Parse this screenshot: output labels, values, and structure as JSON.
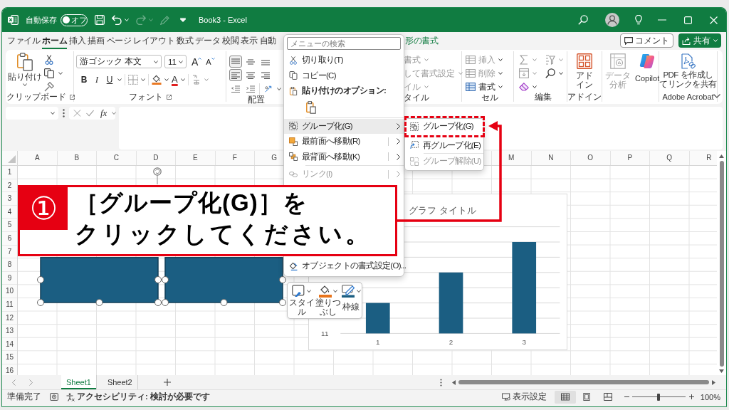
{
  "title_bar": {
    "autosave_label": "自動保存",
    "autosave_toggle": {
      "on": false,
      "label": "オフ"
    },
    "quick_access": [
      {
        "disabled": false
      },
      {
        "disabled": false
      },
      {
        "disabled": true
      },
      {
        "disabled": true
      }
    ],
    "title": "Book3 - Excel"
  },
  "ribbon_tabs": [
    {
      "kind": "standard",
      "label": "ファイル",
      "selected": false
    },
    {
      "kind": "standard",
      "label": "ホーム",
      "selected": true
    },
    {
      "kind": "standard",
      "label": "挿入",
      "selected": false
    },
    {
      "kind": "standard",
      "label": "描画",
      "selected": false
    },
    {
      "kind": "standard",
      "label": "ページ レイアウト",
      "selected": false
    },
    {
      "kind": "standard",
      "label": "数式",
      "selected": false
    },
    {
      "kind": "standard",
      "label": "データ",
      "selected": false
    },
    {
      "kind": "standard",
      "label": "校閲",
      "selected": false
    },
    {
      "kind": "standard",
      "label": "表示",
      "selected": false
    },
    {
      "kind": "standard",
      "label": "自動",
      "selected": false
    },
    {
      "kind": "contextual",
      "label": "形の書式",
      "selected": false
    }
  ],
  "ribbon_actions": {
    "comment": "コメント",
    "share": "共有"
  },
  "ribbon": {
    "clipboard": {
      "paste": "貼り付け",
      "label": "クリップボード"
    },
    "font": {
      "font_name": "游ゴシック 本文",
      "font_size": "11",
      "grow": "A",
      "shrink": "A",
      "bold": "B",
      "italic": "I",
      "underline": "U",
      "font_color": "A",
      "phonetic": {
        "disabled": true
      },
      "label": "フォント"
    },
    "alignment": {
      "buttons": [
        {
          "selected": true
        },
        {
          "selected": false
        },
        {
          "selected": false
        },
        {
          "selected": true
        },
        {
          "selected": false
        },
        {
          "selected": false
        }
      ],
      "label": "配置"
    },
    "styles": {
      "items": [
        {
          "label": "書式",
          "disabled": true
        },
        {
          "label": "して書式設定",
          "disabled": true
        },
        {
          "label": "イル",
          "disabled": true
        }
      ],
      "label": "タイル"
    },
    "cells": {
      "items": [
        {
          "label": "挿入",
          "disabled": true
        },
        {
          "label": "削除",
          "disabled": true
        },
        {
          "label": "書式",
          "disabled": false
        }
      ],
      "label": "セル"
    },
    "editing": {
      "buttons": [
        {
          "disabled": true
        },
        {
          "disabled": true
        },
        {
          "disabled": true
        },
        {
          "disabled": false
        },
        {
          "disabled": false
        }
      ],
      "label": "編集"
    },
    "addins": {
      "button": "アドイン",
      "label": "アドイン"
    },
    "analysis": {
      "data_analysis": {
        "label": "データ分析",
        "disabled": true
      },
      "copilot": "Copilot"
    },
    "acrobat": {
      "button_lines": [
        "PDF を作成し",
        "てリンクを共有"
      ],
      "label": "Adobe Acrobat"
    }
  },
  "formula_bar": {
    "buttons": [
      {
        "disabled": true
      },
      {
        "disabled": true
      }
    ],
    "function_button": "fx"
  },
  "sheet": {
    "columns": [
      "A",
      "B",
      "C",
      "D",
      "E",
      "F",
      "G",
      "M",
      "N",
      "O",
      "P",
      "Q",
      "R"
    ],
    "rows": [
      "1",
      "2",
      "3",
      "4",
      "5",
      "6",
      "7",
      "8",
      "9",
      "10",
      "11",
      "12",
      "13",
      "14",
      "15",
      "16"
    ]
  },
  "chart": {
    "title": "グラフ タイトル",
    "y_axis_labels": [
      "11"
    ],
    "x_axis_labels": [
      "1",
      "2",
      "3"
    ]
  },
  "mini_toolbar": {
    "items": [
      {
        "label": "スタイル"
      },
      {
        "label": "塗りつぶし"
      },
      {
        "label": "枠線"
      }
    ]
  },
  "context_menu": {
    "search": {
      "placeholder": "メニューの検索"
    },
    "items": [
      {
        "kind": "command",
        "label": "切り取り(T)",
        "disabled": false,
        "expanded": false
      },
      {
        "kind": "command",
        "label": "コピー(C)",
        "disabled": false,
        "expanded": false
      },
      {
        "kind": "heading",
        "label": "貼り付けのオプション:"
      },
      {
        "kind": "paste_options"
      },
      {
        "kind": "separator"
      },
      {
        "kind": "submenu",
        "label": "グループ化(G)",
        "disabled": false,
        "expanded": true
      },
      {
        "kind": "split",
        "label": "最前面へ移動(R)",
        "disabled": false,
        "expanded": false
      },
      {
        "kind": "split",
        "label": "最背面へ移動(K)",
        "disabled": false,
        "expanded": false
      },
      {
        "kind": "separator"
      },
      {
        "kind": "split",
        "label": "リンク(I)",
        "disabled": true,
        "expanded": false
      },
      {
        "kind": "command",
        "label": "オブジェクトの書式設定(O)...",
        "disabled": false,
        "expanded": false
      }
    ]
  },
  "submenu": {
    "items": [
      {
        "kind": "command",
        "label": "グループ化(G)",
        "disabled": false
      },
      {
        "kind": "command",
        "label": "再グループ化(E)",
        "disabled": false
      },
      {
        "kind": "separator"
      },
      {
        "kind": "command",
        "label": "グループ解除(U)",
        "disabled": true
      }
    ]
  },
  "callout": {
    "badge": "①",
    "lines": [
      "［グループ化(G)］を",
      "クリックしてください。"
    ]
  },
  "sheet_tabs": [
    {
      "label": "Sheet1",
      "selected": true
    },
    {
      "label": "Sheet2",
      "selected": false
    }
  ],
  "status_bar": {
    "ready": "準備完了",
    "accessibility": "アクセシビリティ: 検討が必要です",
    "display_settings": "表示設定",
    "views": [
      {
        "selected": true
      },
      {
        "selected": false
      },
      {
        "selected": false
      }
    ],
    "zoom": {
      "level": 0.5,
      "label": "100%"
    }
  }
}
